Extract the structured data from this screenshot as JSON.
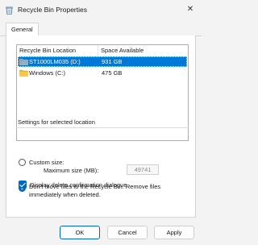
{
  "window": {
    "title": "Recycle Bin Properties",
    "close_glyph": "✕"
  },
  "tabs": [
    {
      "label": "General"
    }
  ],
  "list": {
    "columns": [
      "Recycle Bin Location",
      "Space Available"
    ],
    "rows": [
      {
        "name": "ST1000LM035 (D:)",
        "space": "931 GB",
        "icon": "drive-icon",
        "selected": true
      },
      {
        "name": "Windows (C:)",
        "space": "475 GB",
        "icon": "folder-icon",
        "selected": false
      }
    ]
  },
  "settings": {
    "legend": "Settings for selected location",
    "custom_size_label": "Custom size:",
    "max_size_label": "Maximum size (MB):",
    "max_size_value": "49741",
    "dont_move_label": "Don't move files to the Recycle Bin. Remove files immediately when deleted.",
    "selected_option": "dont_move"
  },
  "confirm": {
    "label": "Display delete confirmation dialogue",
    "checked": true
  },
  "buttons": {
    "ok": "OK",
    "cancel": "Cancel",
    "apply": "Apply"
  },
  "colors": {
    "accent": "#0078d7",
    "control_accent": "#0067c0"
  }
}
